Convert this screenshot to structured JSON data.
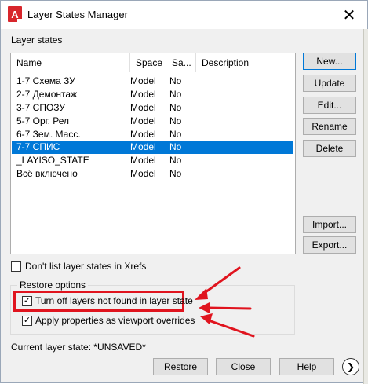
{
  "window": {
    "app_icon_letter": "A",
    "title": "Layer States Manager",
    "close_symbol": "✕"
  },
  "layer_states_label": "Layer states",
  "columns": [
    "Name",
    "Space",
    "Sa...",
    "Description"
  ],
  "rows": [
    {
      "name": "1-7 Схема ЗУ",
      "space": "Model",
      "save": "No",
      "description": ""
    },
    {
      "name": "2-7 Демонтаж",
      "space": "Model",
      "save": "No",
      "description": ""
    },
    {
      "name": "3-7 СПОЗУ",
      "space": "Model",
      "save": "No",
      "description": ""
    },
    {
      "name": "5-7 Орг. Рел",
      "space": "Model",
      "save": "No",
      "description": ""
    },
    {
      "name": "6-7 Зем. Масс.",
      "space": "Model",
      "save": "No",
      "description": ""
    },
    {
      "name": "7-7 СПИС",
      "space": "Model",
      "save": "No",
      "description": ""
    },
    {
      "name": "_LAYISO_STATE",
      "space": "Model",
      "save": "No",
      "description": ""
    },
    {
      "name": "Всё включено",
      "space": "Model",
      "save": "No",
      "description": ""
    }
  ],
  "selected_row": "7-7 СПИС",
  "side_buttons": {
    "new": "New...",
    "update": "Update",
    "edit": "Edit...",
    "rename": "Rename",
    "delete": "Delete",
    "import": "Import...",
    "export": "Export..."
  },
  "dont_list_xrefs": {
    "label": "Don't list layer states in Xrefs",
    "checked": false
  },
  "restore_options": {
    "title": "Restore options",
    "turn_off_layers": {
      "label": "Turn off layers not found in layer state",
      "checked": true
    },
    "apply_properties": {
      "label": "Apply properties as viewport overrides",
      "checked": true
    }
  },
  "current_state": "Current layer state: *UNSAVED*",
  "bottom_buttons": {
    "restore": "Restore",
    "close": "Close",
    "help": "Help"
  },
  "expand_symbol": "❯",
  "checkmark": "✓",
  "colors": {
    "selection": "#0078d7",
    "annotation_red": "#e0141e",
    "app_icon_red": "#d8262c"
  }
}
